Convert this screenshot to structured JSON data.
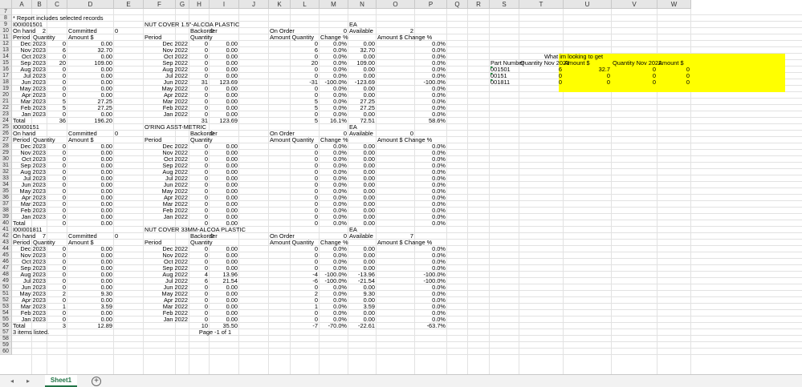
{
  "columns": [
    "A",
    "B",
    "C",
    "D",
    "E",
    "F",
    "G",
    "H",
    "I",
    "J",
    "K",
    "L",
    "M",
    "N",
    "O",
    "P",
    "Q",
    "R",
    "S",
    "T",
    "U",
    "V",
    "W"
  ],
  "rows": [
    "7",
    "8",
    "9",
    "10",
    "11",
    "12",
    "13",
    "14",
    "15",
    "16",
    "17",
    "18",
    "19",
    "20",
    "21",
    "22",
    "23",
    "24",
    "25",
    "26",
    "27",
    "28",
    "29",
    "30",
    "31",
    "32",
    "33",
    "34",
    "35",
    "36",
    "37",
    "38",
    "39",
    "40",
    "41",
    "42",
    "43",
    "44",
    "45",
    "46",
    "47",
    "48",
    "49",
    "50",
    "51",
    "52",
    "53",
    "54",
    "55",
    "56",
    "57",
    "58",
    "59",
    "60"
  ],
  "report_note": "* Report includes selected records",
  "months_2023": [
    "Dec 2023",
    "Nov 2023",
    "Oct 2023",
    "Sep 2023",
    "Aug 2023",
    "Jul 2023",
    "Jun 2023",
    "May 2023",
    "Apr 2023",
    "Mar 2023",
    "Feb 2023",
    "Jan 2023"
  ],
  "months_2022": [
    "Dec 2022",
    "Nov 2022",
    "Oct 2022",
    "Sep 2022",
    "Aug 2022",
    "Jul 2022",
    "Jun 2022",
    "May 2022",
    "Apr 2022",
    "Mar 2022",
    "Feb 2022",
    "Jan 2022"
  ],
  "labels": {
    "on_hand": "On hand",
    "period": "Period",
    "quantity": "Quantity",
    "committed": "Committed",
    "amount": "Amount $",
    "backorder": "Backorder",
    "on_order": "On Order",
    "amount_quantity": "Amount Quantity",
    "change_pct": "Change %",
    "available": "Available",
    "amount_change": "Amount $   Change %",
    "total": "Total"
  },
  "items": [
    {
      "part": "I00I001501",
      "desc": "NUT COVER 1.5\"-ALCOA PLASTIC",
      "uom": "EA",
      "on_hand": "2",
      "committed": "0",
      "backorder": "0",
      "on_order": "0",
      "available": "2",
      "rows": [
        {
          "q": "0",
          "a": "0.00",
          "pq": "0",
          "pa": "0.00",
          "dq": "0",
          "dp": "0.0%",
          "da": "0.00",
          "ap": "0.0%"
        },
        {
          "q": "6",
          "a": "32.70",
          "pq": "0",
          "pa": "0.00",
          "dq": "6",
          "dp": "0.0%",
          "da": "32.70",
          "ap": "0.0%"
        },
        {
          "q": "0",
          "a": "0.00",
          "pq": "0",
          "pa": "0.00",
          "dq": "0",
          "dp": "0.0%",
          "da": "0.00",
          "ap": "0.0%"
        },
        {
          "q": "20",
          "a": "109.00",
          "pq": "0",
          "pa": "0.00",
          "dq": "20",
          "dp": "0.0%",
          "da": "109.00",
          "ap": "0.0%"
        },
        {
          "q": "0",
          "a": "0.00",
          "pq": "0",
          "pa": "0.00",
          "dq": "0",
          "dp": "0.0%",
          "da": "0.00",
          "ap": "0.0%"
        },
        {
          "q": "0",
          "a": "0.00",
          "pq": "0",
          "pa": "0.00",
          "dq": "0",
          "dp": "0.0%",
          "da": "0.00",
          "ap": "0.0%"
        },
        {
          "q": "0",
          "a": "0.00",
          "pq": "31",
          "pa": "123.69",
          "dq": "-31",
          "dp": "-100.0%",
          "da": "-123.69",
          "ap": "-100.0%"
        },
        {
          "q": "0",
          "a": "0.00",
          "pq": "0",
          "pa": "0.00",
          "dq": "0",
          "dp": "0.0%",
          "da": "0.00",
          "ap": "0.0%"
        },
        {
          "q": "0",
          "a": "0.00",
          "pq": "0",
          "pa": "0.00",
          "dq": "0",
          "dp": "0.0%",
          "da": "0.00",
          "ap": "0.0%"
        },
        {
          "q": "5",
          "a": "27.25",
          "pq": "0",
          "pa": "0.00",
          "dq": "5",
          "dp": "0.0%",
          "da": "27.25",
          "ap": "0.0%"
        },
        {
          "q": "5",
          "a": "27.25",
          "pq": "0",
          "pa": "0.00",
          "dq": "5",
          "dp": "0.0%",
          "da": "27.25",
          "ap": "0.0%"
        },
        {
          "q": "0",
          "a": "0.00",
          "pq": "0",
          "pa": "0.00",
          "dq": "0",
          "dp": "0.0%",
          "da": "0.00",
          "ap": "0.0%"
        }
      ],
      "total": {
        "q": "36",
        "a": "196.20",
        "pq": "31",
        "pa": "123.69",
        "dq": "5",
        "dp": "16.1%",
        "da": "72.51",
        "ap": "58.6%"
      }
    },
    {
      "part": "I00I00151",
      "desc": "O'RING ASST-METRIC",
      "uom": "EA",
      "on_hand": "",
      "committed": "0",
      "backorder": "0",
      "on_order": "0",
      "available": "0",
      "rows": [
        {
          "q": "0",
          "a": "0.00",
          "pq": "0",
          "pa": "0.00",
          "dq": "0",
          "dp": "0.0%",
          "da": "0.00",
          "ap": "0.0%"
        },
        {
          "q": "0",
          "a": "0.00",
          "pq": "0",
          "pa": "0.00",
          "dq": "0",
          "dp": "0.0%",
          "da": "0.00",
          "ap": "0.0%"
        },
        {
          "q": "0",
          "a": "0.00",
          "pq": "0",
          "pa": "0.00",
          "dq": "0",
          "dp": "0.0%",
          "da": "0.00",
          "ap": "0.0%"
        },
        {
          "q": "0",
          "a": "0.00",
          "pq": "0",
          "pa": "0.00",
          "dq": "0",
          "dp": "0.0%",
          "da": "0.00",
          "ap": "0.0%"
        },
        {
          "q": "0",
          "a": "0.00",
          "pq": "0",
          "pa": "0.00",
          "dq": "0",
          "dp": "0.0%",
          "da": "0.00",
          "ap": "0.0%"
        },
        {
          "q": "0",
          "a": "0.00",
          "pq": "0",
          "pa": "0.00",
          "dq": "0",
          "dp": "0.0%",
          "da": "0.00",
          "ap": "0.0%"
        },
        {
          "q": "0",
          "a": "0.00",
          "pq": "0",
          "pa": "0.00",
          "dq": "0",
          "dp": "0.0%",
          "da": "0.00",
          "ap": "0.0%"
        },
        {
          "q": "0",
          "a": "0.00",
          "pq": "0",
          "pa": "0.00",
          "dq": "0",
          "dp": "0.0%",
          "da": "0.00",
          "ap": "0.0%"
        },
        {
          "q": "0",
          "a": "0.00",
          "pq": "0",
          "pa": "0.00",
          "dq": "0",
          "dp": "0.0%",
          "da": "0.00",
          "ap": "0.0%"
        },
        {
          "q": "0",
          "a": "0.00",
          "pq": "0",
          "pa": "0.00",
          "dq": "0",
          "dp": "0.0%",
          "da": "0.00",
          "ap": "0.0%"
        },
        {
          "q": "0",
          "a": "0.00",
          "pq": "0",
          "pa": "0.00",
          "dq": "0",
          "dp": "0.0%",
          "da": "0.00",
          "ap": "0.0%"
        },
        {
          "q": "0",
          "a": "0.00",
          "pq": "0",
          "pa": "0.00",
          "dq": "0",
          "dp": "0.0%",
          "da": "0.00",
          "ap": "0.0%"
        }
      ],
      "total": {
        "q": "0",
        "a": "0.00",
        "pq": "0",
        "pa": "0.00",
        "dq": "0",
        "dp": "0.0%",
        "da": "0.00",
        "ap": "0.0%"
      }
    },
    {
      "part": "I00I001811",
      "desc": "NUT COVER 33MM-ALCOA PLASTIC",
      "uom": "EA",
      "on_hand": "7",
      "committed": "0",
      "backorder": "0",
      "on_order": "0",
      "available": "7",
      "rows": [
        {
          "q": "0",
          "a": "0.00",
          "pq": "0",
          "pa": "0.00",
          "dq": "0",
          "dp": "0.0%",
          "da": "0.00",
          "ap": "0.0%"
        },
        {
          "q": "0",
          "a": "0.00",
          "pq": "0",
          "pa": "0.00",
          "dq": "0",
          "dp": "0.0%",
          "da": "0.00",
          "ap": "0.0%"
        },
        {
          "q": "0",
          "a": "0.00",
          "pq": "0",
          "pa": "0.00",
          "dq": "0",
          "dp": "0.0%",
          "da": "0.00",
          "ap": "0.0%"
        },
        {
          "q": "0",
          "a": "0.00",
          "pq": "0",
          "pa": "0.00",
          "dq": "0",
          "dp": "0.0%",
          "da": "0.00",
          "ap": "0.0%"
        },
        {
          "q": "0",
          "a": "0.00",
          "pq": "4",
          "pa": "13.96",
          "dq": "-4",
          "dp": "-100.0%",
          "da": "-13.96",
          "ap": "-100.0%"
        },
        {
          "q": "0",
          "a": "0.00",
          "pq": "6",
          "pa": "21.54",
          "dq": "-6",
          "dp": "-100.0%",
          "da": "-21.54",
          "ap": "-100.0%"
        },
        {
          "q": "0",
          "a": "0.00",
          "pq": "0",
          "pa": "0.00",
          "dq": "0",
          "dp": "0.0%",
          "da": "0.00",
          "ap": "0.0%"
        },
        {
          "q": "2",
          "a": "9.30",
          "pq": "0",
          "pa": "0.00",
          "dq": "2",
          "dp": "0.0%",
          "da": "9.30",
          "ap": "0.0%"
        },
        {
          "q": "0",
          "a": "0.00",
          "pq": "0",
          "pa": "0.00",
          "dq": "0",
          "dp": "0.0%",
          "da": "0.00",
          "ap": "0.0%"
        },
        {
          "q": "1",
          "a": "3.59",
          "pq": "0",
          "pa": "0.00",
          "dq": "1",
          "dp": "0.0%",
          "da": "3.59",
          "ap": "0.0%"
        },
        {
          "q": "0",
          "a": "0.00",
          "pq": "0",
          "pa": "0.00",
          "dq": "0",
          "dp": "0.0%",
          "da": "0.00",
          "ap": "0.0%"
        },
        {
          "q": "0",
          "a": "0.00",
          "pq": "0",
          "pa": "0.00",
          "dq": "0",
          "dp": "0.0%",
          "da": "0.00",
          "ap": "0.0%"
        }
      ],
      "total": {
        "q": "3",
        "a": "12.89",
        "pq": "10",
        "pa": "35.50",
        "dq": "-7",
        "dp": "-70.0%",
        "da": "-22.61",
        "ap": "-63.7%"
      }
    }
  ],
  "page_footer": "Page -1 of 1",
  "items_listed": "3 items listed.",
  "yellow_box": {
    "title": "What im looking to get",
    "headers": [
      "Part Number",
      "Quantity Nov 2023",
      "Amount $",
      "Quantity Nov 2022",
      "Amount $"
    ],
    "rows": [
      [
        "001501",
        "6",
        "32.7",
        "0",
        "0"
      ],
      [
        "00151",
        "0",
        "0",
        "0",
        "0"
      ],
      [
        "001811",
        "0",
        "0",
        "0",
        "0"
      ]
    ],
    "color": "#ffff00"
  },
  "tabs": {
    "sheet1": "Sheet1",
    "add": "+"
  },
  "nav": {
    "prev": "◂",
    "next": "▸"
  },
  "accent": "#217346"
}
